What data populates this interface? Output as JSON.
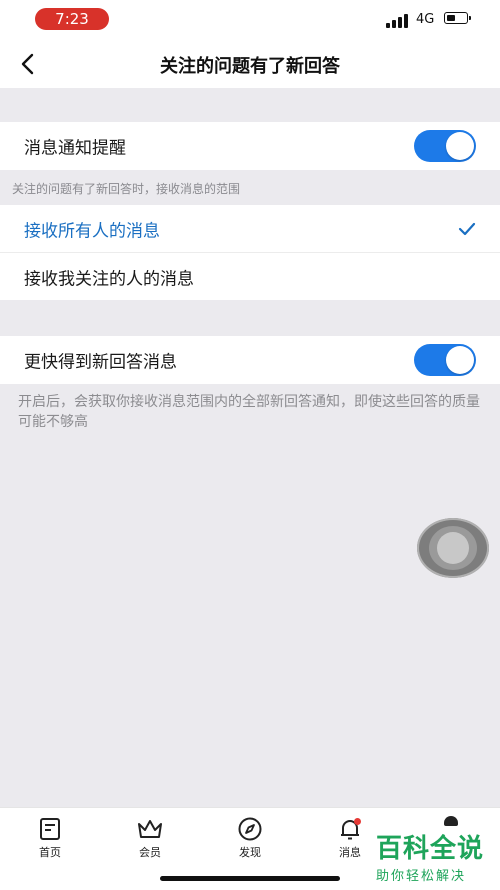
{
  "status_bar": {
    "time": "7:23",
    "network": "4G"
  },
  "nav": {
    "title": "关注的问题有了新回答"
  },
  "notify_row": {
    "label": "消息通知提醒",
    "enabled": true
  },
  "range_note": "关注的问题有了新回答时，接收消息的范围",
  "options": [
    {
      "label": "接收所有人的消息",
      "selected": true
    },
    {
      "label": "接收我关注的人的消息",
      "selected": false
    }
  ],
  "faster_row": {
    "label": "更快得到新回答消息",
    "enabled": true
  },
  "faster_desc": "开启后，会获取你接收消息范围内的全部新回答通知，即使这些回答的质量可能不够高",
  "tabs": [
    {
      "label": "首页",
      "icon": "home-icon"
    },
    {
      "label": "会员",
      "icon": "crown-icon"
    },
    {
      "label": "发现",
      "icon": "compass-icon"
    },
    {
      "label": "消息",
      "icon": "bell-icon"
    }
  ],
  "watermark": {
    "title": "百科全说",
    "subtitle": "助你轻松解决"
  },
  "colors": {
    "accent": "#1d7ae8",
    "selected_text": "#1a6fc2",
    "time_pill": "#d8322a",
    "watermark": "#1ea45a"
  }
}
